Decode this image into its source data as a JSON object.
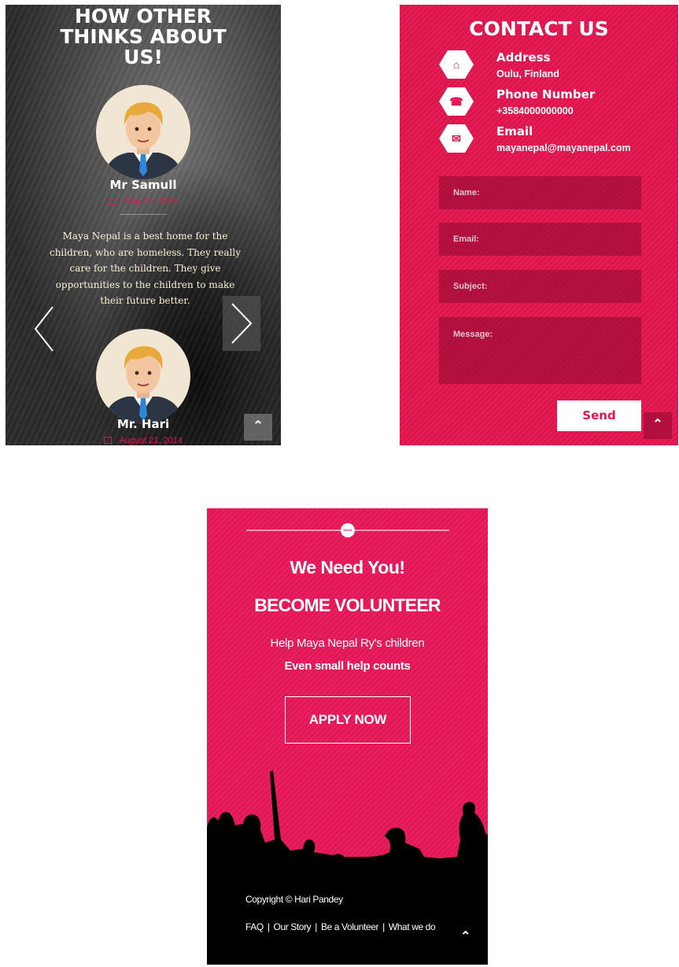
{
  "testimonials": {
    "title": "HOW OTHER THINKS ABOUT US!",
    "items": [
      {
        "name": "Mr Samull",
        "date": "May 21, 2014",
        "quote": "Maya Nepal is a best home for the children, who are homeless. They really care for the children. They give opportunities to the children to make their future better."
      },
      {
        "name": "Mr. Hari",
        "date": "August 21, 2014"
      }
    ],
    "icons": [
      "arrow-left-icon",
      "arrow-right-icon",
      "chevron-up-icon",
      "calendar-icon"
    ]
  },
  "contact": {
    "title": "CONTACT US",
    "address_label": "Address",
    "address_value": "Oulu, Finland",
    "phone_label": "Phone Number",
    "phone_value": "+3584000000000",
    "email_label": "Email",
    "email_value": "mayanepal@mayanepal.com",
    "form": {
      "name_placeholder": "Name:",
      "email_placeholder": "Email:",
      "subject_placeholder": "Subject:",
      "message_placeholder": "Message:",
      "send_label": "Send"
    },
    "icons": [
      "home-icon",
      "phone-icon",
      "envelope-icon"
    ]
  },
  "volunteer": {
    "logo_text": "MAYA NEPAL",
    "heading1": "We Need You!",
    "heading2": "BECOME VOLUNTEER",
    "line1": "Help Maya Nepal Ry's children",
    "line2": "Even small help counts",
    "apply_label": "APPLY NOW",
    "copyright": "Copyright © Hari Pandey",
    "links": [
      "FAQ",
      "Our Story",
      "Be a Volunteer",
      "What we do"
    ]
  },
  "colors": {
    "brand_pink": "#e3164f",
    "volunteer_pink": "#e8185a",
    "quote_text": "#f7efd5"
  }
}
